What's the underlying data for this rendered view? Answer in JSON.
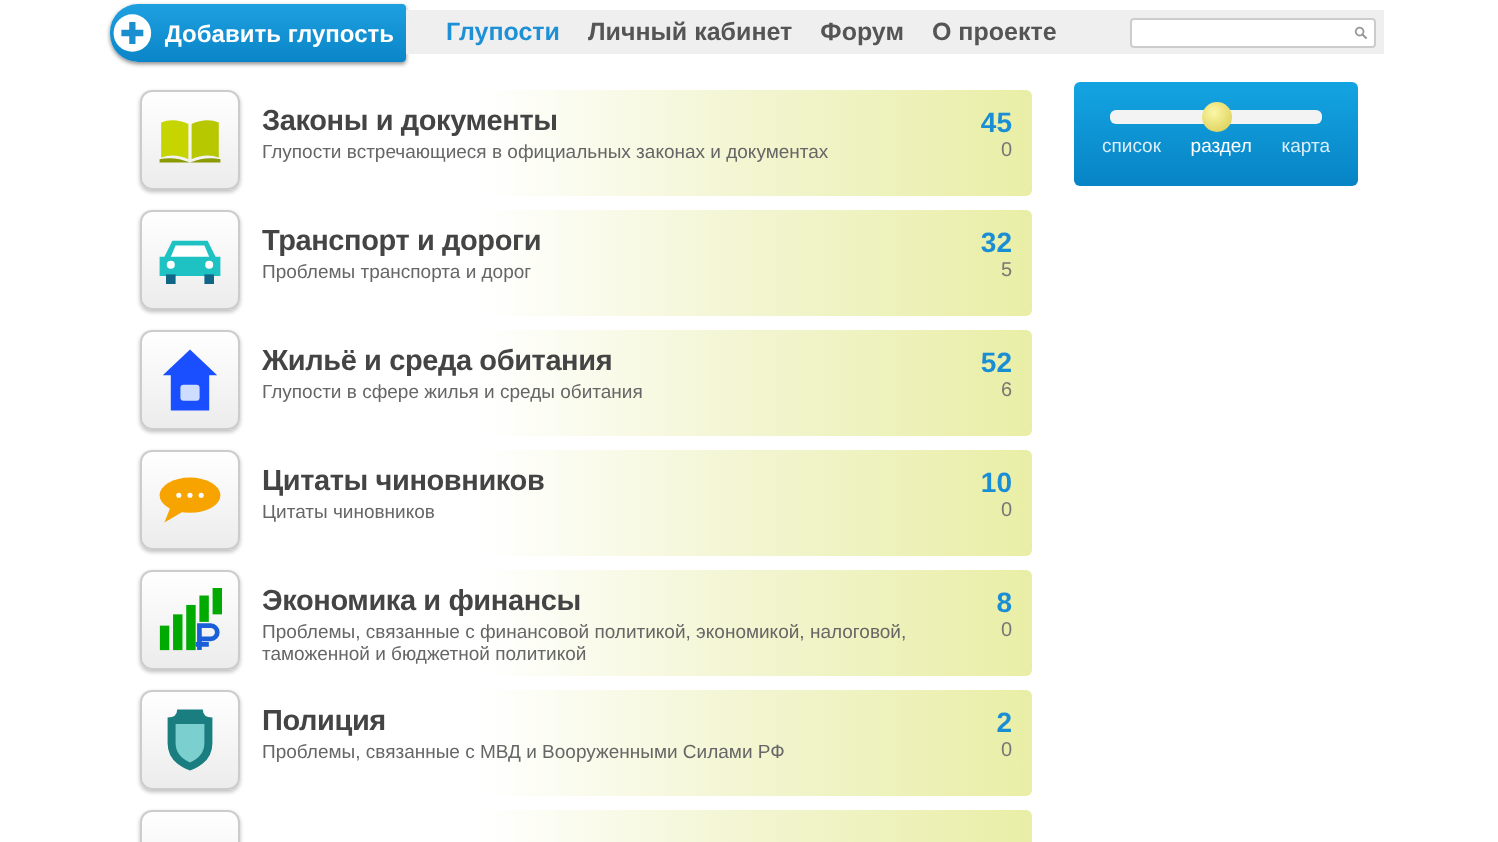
{
  "header": {
    "add_button": "Добавить глупость",
    "nav": [
      {
        "label": "Глупости",
        "selected": true
      },
      {
        "label": "Личный кабинет",
        "selected": false
      },
      {
        "label": "Форум",
        "selected": false
      },
      {
        "label": "О проекте",
        "selected": false
      }
    ]
  },
  "categories": [
    {
      "kind": "book",
      "title": "Законы и документы",
      "description": "Глупости встречающиеся в официальных законах и документах",
      "count": "45",
      "sub_count": "0"
    },
    {
      "kind": "car",
      "title": "Транспорт и дороги",
      "description": "Проблемы транспорта и дорог",
      "count": "32",
      "sub_count": "5"
    },
    {
      "kind": "house",
      "title": "Жильё и среда обитания",
      "description": "Глупости в сфере жилья и среды обитания",
      "count": "52",
      "sub_count": "6"
    },
    {
      "kind": "speech",
      "title": "Цитаты чиновников",
      "description": "Цитаты чиновников",
      "count": "10",
      "sub_count": "0"
    },
    {
      "kind": "chart",
      "title": "Экономика и финансы",
      "description": "Проблемы, связанные с финансовой политикой, экономикой, налоговой, таможенной и бюджетной политикой",
      "count": "8",
      "sub_count": "0"
    },
    {
      "kind": "shield",
      "title": "Полиция",
      "description": "Проблемы, связанные с МВД и Вооруженными Силами РФ",
      "count": "2",
      "sub_count": "0"
    }
  ],
  "view_switch": [
    {
      "label": "список",
      "selected": false
    },
    {
      "label": "раздел",
      "selected": true
    },
    {
      "label": "карта",
      "selected": false
    }
  ]
}
